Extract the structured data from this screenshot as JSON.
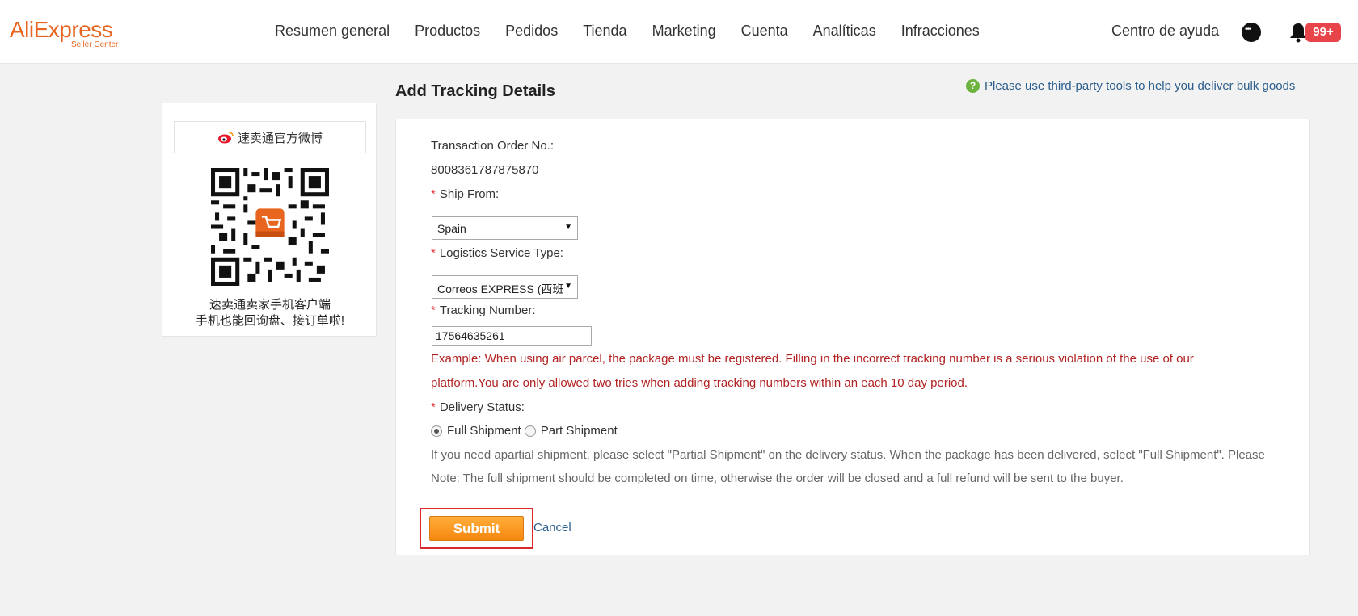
{
  "header": {
    "logo_text": "AliExpress",
    "logo_sub": "Seller Center",
    "nav": [
      {
        "label": "Resumen general"
      },
      {
        "label": "Productos"
      },
      {
        "label": "Pedidos"
      },
      {
        "label": "Tienda"
      },
      {
        "label": "Marketing"
      },
      {
        "label": "Cuenta"
      },
      {
        "label": "Analíticas"
      },
      {
        "label": "Infracciones"
      }
    ],
    "help_label": "Centro de ayuda",
    "notification_count": "99+",
    "icons": {
      "chat": "chat-bubble-icon",
      "bell": "bell-icon"
    }
  },
  "sidebar": {
    "weibo_label": "速卖通官方微博",
    "qr_caption_line1": "速卖通卖家手机客户端",
    "qr_caption_line2": "手机也能回询盘、接订单啦!"
  },
  "page": {
    "title": "Add Tracking Details",
    "tip": "Please use third-party tools to help you deliver bulk goods"
  },
  "form": {
    "order_label": "Transaction Order No.:",
    "order_value": "8008361787875870",
    "required_mark": "*",
    "ship_from_label": "Ship From:",
    "ship_from_value": "Spain",
    "logistics_label": "Logistics Service Type:",
    "logistics_value": "Correos EXPRESS (西班",
    "tracking_label": "Tracking Number:",
    "tracking_value": "17564635261",
    "warning_line1": "Example: When using air parcel, the package must be registered. Filling in the incorrect tracking number is a serious violation of the use of our",
    "warning_line2": "platform.You are only allowed two tries when adding tracking numbers within an each 10 day period.",
    "delivery_label": "Delivery Status:",
    "full_shipment_label": "Full Shipment",
    "part_shipment_label": "Part Shipment",
    "selected_delivery": "Full Shipment",
    "note_line1": "If you need apartial shipment, please select \"Partial Shipment\" on the delivery status. When the package has been delivered, select \"Full Shipment\". Please",
    "note_line2": "Note: The full shipment should be completed on time, otherwise the order will be closed and a full refund will be sent to the buyer.",
    "submit_label": "Submit",
    "cancel_label": "Cancel"
  },
  "colors": {
    "brand": "#e8651f",
    "warning": "#b22222",
    "link": "#2b5e8c",
    "submit": "#f6870f",
    "badge": "#e8454a",
    "highlight_frame": "#d9272e"
  }
}
